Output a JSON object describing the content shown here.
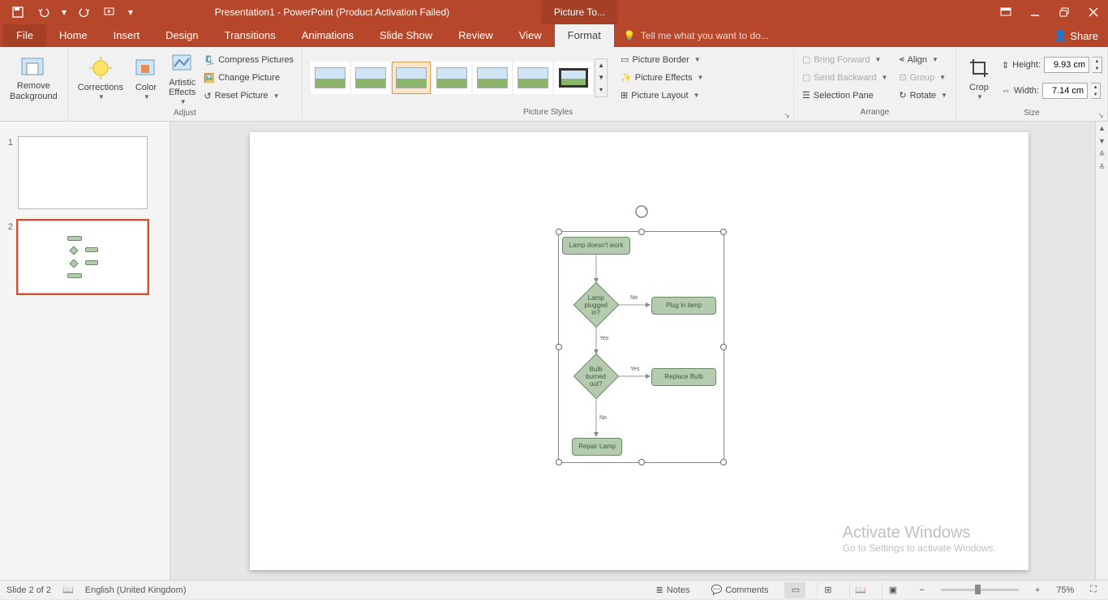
{
  "title": "Presentation1 - PowerPoint (Product Activation Failed)",
  "contextual_tab": "Picture To...",
  "tabs": {
    "file": "File",
    "home": "Home",
    "insert": "Insert",
    "design": "Design",
    "transitions": "Transitions",
    "animations": "Animations",
    "slideshow": "Slide Show",
    "review": "Review",
    "view": "View",
    "format": "Format"
  },
  "tell_me": "Tell me what you want to do...",
  "share": "Share",
  "ribbon": {
    "remove_bg": "Remove\nBackground",
    "corrections": "Corrections",
    "color": "Color",
    "artistic": "Artistic\nEffects",
    "compress": "Compress Pictures",
    "change": "Change Picture",
    "reset": "Reset Picture",
    "adjust_label": "Adjust",
    "styles_label": "Picture Styles",
    "border": "Picture Border",
    "effects": "Picture Effects",
    "layout": "Picture Layout",
    "bring_forward": "Bring Forward",
    "send_backward": "Send Backward",
    "selection_pane": "Selection Pane",
    "align": "Align",
    "group": "Group",
    "rotate": "Rotate",
    "arrange_label": "Arrange",
    "crop": "Crop",
    "height_label": "Height:",
    "width_label": "Width:",
    "height_value": "9.93 cm",
    "width_value": "7.14 cm",
    "size_label": "Size"
  },
  "flowchart": {
    "n1": "Lamp doesn't work",
    "n2": "Lamp plugged in?",
    "n3": "Plug in lamp",
    "n4": "Bulb burned out?",
    "n5": "Replace Bulb",
    "n6": "Repair Lamp",
    "yes": "Yes",
    "no": "No"
  },
  "watermark": {
    "title": "Activate Windows",
    "sub": "Go to Settings to activate Windows."
  },
  "status": {
    "slide_counter": "Slide 2 of 2",
    "language": "English (United Kingdom)",
    "notes": "Notes",
    "comments": "Comments",
    "zoom": "75%"
  },
  "thumbs": {
    "n1": "1",
    "n2": "2"
  }
}
